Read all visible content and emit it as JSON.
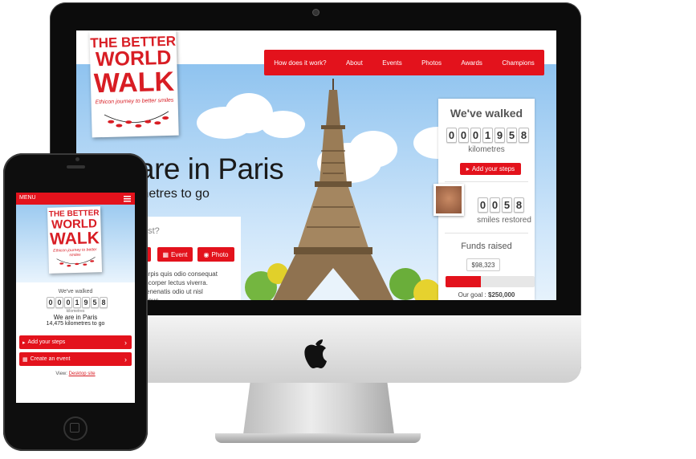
{
  "site": {
    "logo": {
      "line1": "THE BETTER",
      "line2": "WORLD",
      "line3": "WALK",
      "tagline": "Ethicon journey to better smiles"
    },
    "nav": [
      "How does it work?",
      "About",
      "Events",
      "Photos",
      "Awards",
      "Champions"
    ],
    "hero": {
      "headline": "are in Paris",
      "subline": "metres to go"
    },
    "left_panel": {
      "question": "est?",
      "buttons": [
        {
          "label": "",
          "icon": "steps-icon"
        },
        {
          "label": "Event",
          "icon": "calendar-icon"
        },
        {
          "label": "Photo",
          "icon": "camera-icon"
        }
      ],
      "text": "turpis quis odio consequat\nmcorper lectus viverra.\nvenenatis odio ut nisl\nmpus."
    },
    "sidebar": {
      "title": "We've walked",
      "km_digits": [
        "0",
        "0",
        "0",
        "1",
        "9",
        "5",
        "8"
      ],
      "km_label": "kilometres",
      "add_steps": "Add your steps",
      "smiles_digits": [
        "0",
        "0",
        "5",
        "8"
      ],
      "smiles_label": "smiles restored",
      "funds_title": "Funds raised",
      "funds_amount": "$98,323",
      "funds_progress": 0.393,
      "goal_label": "Our goal :",
      "goal_value": "$250,000"
    }
  },
  "mobile": {
    "menu_label": "MENU",
    "walked_label": "We've walked",
    "km_digits": [
      "0",
      "0",
      "0",
      "1",
      "9",
      "5",
      "8"
    ],
    "km_label": "kilometres",
    "paris": "We are in Paris",
    "to_go": "14,475 kilometres to go",
    "add_steps": "Add your steps",
    "create_event": "Create an event",
    "view_label": "View:",
    "desktop_link": "Desktop site"
  },
  "colors": {
    "brand_red": "#e3121c",
    "logo_red": "#d81d24"
  }
}
